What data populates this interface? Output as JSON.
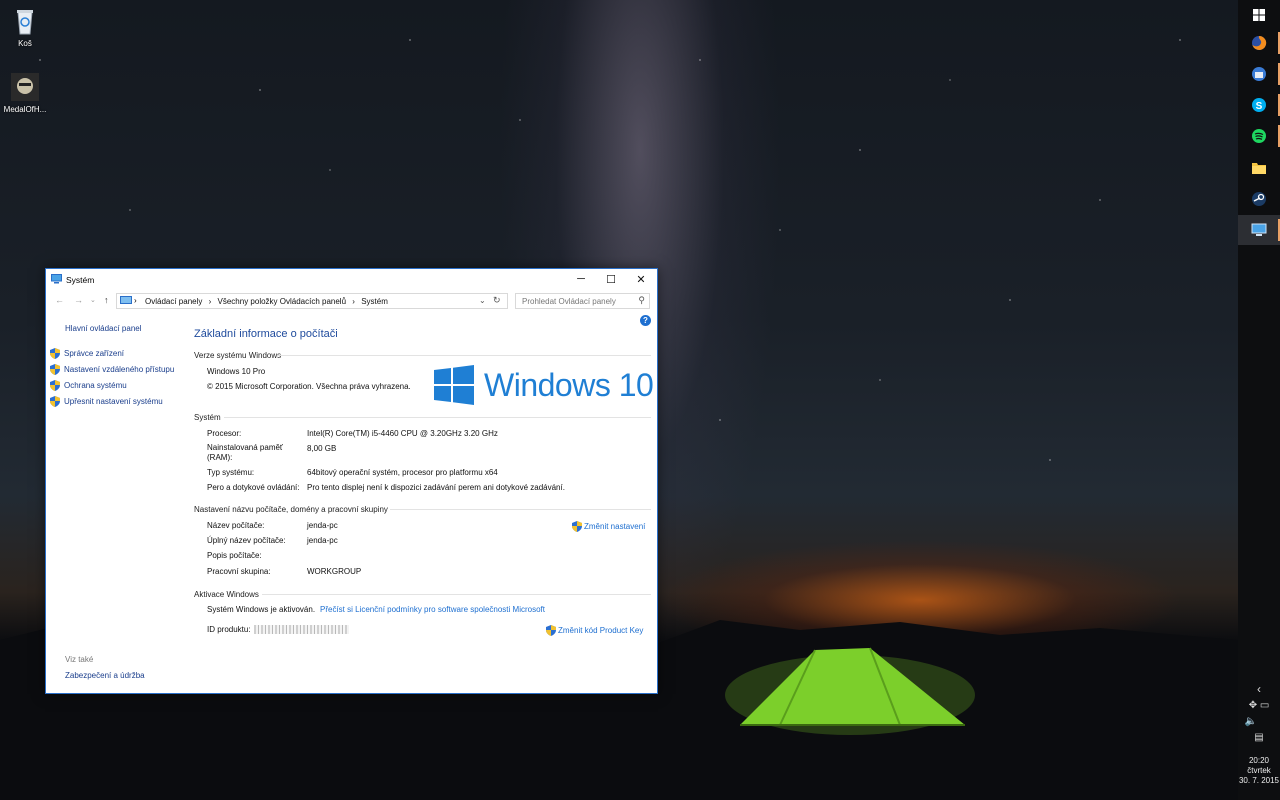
{
  "desktop": {
    "icons": [
      {
        "label": "Koš",
        "icon": "recycle-bin-icon"
      },
      {
        "label": "MedalOfH...",
        "icon": "game-icon"
      }
    ]
  },
  "taskbar": {
    "pinned": [
      {
        "name": "start-button",
        "icon": "windows-logo"
      },
      {
        "name": "firefox",
        "icon": "firefox-icon"
      },
      {
        "name": "thunderbird",
        "icon": "thunderbird-icon"
      },
      {
        "name": "skype",
        "icon": "skype-icon"
      },
      {
        "name": "spotify",
        "icon": "spotify-icon"
      },
      {
        "name": "file-explorer",
        "icon": "folder-icon"
      },
      {
        "name": "steam",
        "icon": "steam-icon"
      },
      {
        "name": "system-control-panel",
        "icon": "system-icon"
      }
    ],
    "tray": {
      "chevron": "‹",
      "time": "20:20",
      "day": "čtvrtek",
      "date": "30. 7. 2015"
    },
    "accent_color": "#e8a066"
  },
  "window": {
    "title": "Systém",
    "controls": {
      "minimize": "─",
      "maximize": "☐",
      "close": "✕"
    },
    "address": {
      "crumbs": [
        "Ovládací panely",
        "Všechny položky Ovládacích panelů",
        "Systém"
      ],
      "separator": "›"
    },
    "search_placeholder": "Prohledat Ovládací panely",
    "sidebar": {
      "home": "Hlavní ovládací panel",
      "links": [
        "Správce zařízení",
        "Nastavení vzdáleného přístupu",
        "Ochrana systému",
        "Upřesnit nastavení systému"
      ],
      "see_also": "Viz také",
      "see_also_links": [
        "Zabezpečení a údržba"
      ]
    },
    "main": {
      "title": "Základní informace o počítači",
      "help": "?",
      "edition": {
        "heading": "Verze systému Windows",
        "name": "Windows 10 Pro",
        "copyright": "© 2015 Microsoft Corporation. Všechna práva vyhrazena.",
        "logo_text": "Windows 10"
      },
      "system": {
        "heading": "Systém",
        "processor_label": "Procesor:",
        "processor_value": "Intel(R) Core(TM) i5-4460  CPU @ 3.20GHz   3.20 GHz",
        "ram_label_1": "Nainstalovaná paměť",
        "ram_label_2": "(RAM):",
        "ram_value": "8,00 GB",
        "type_label": "Typ systému:",
        "type_value": "64bitový operační systém, procesor pro platformu x64",
        "pen_label": "Pero a dotykové ovládání:",
        "pen_value": "Pro tento displej není k dispozici zadávání perem ani dotykové zadávání."
      },
      "computer_name": {
        "heading": "Nastavení názvu počítače, domény a pracovní skupiny",
        "name_label": "Název počítače:",
        "name_value": "jenda-pc",
        "full_label": "Úplný název počítače:",
        "full_value": "jenda-pc",
        "desc_label": "Popis počítače:",
        "desc_value": "",
        "workgroup_label": "Pracovní skupina:",
        "workgroup_value": "WORKGROUP",
        "change_link": "Změnit nastavení"
      },
      "activation": {
        "heading": "Aktivace Windows",
        "status": "Systém Windows je aktivován.",
        "license_link": "Přečíst si Licenční podmínky pro software společnosti Microsoft",
        "product_id_label": "ID produktu:",
        "change_key_link": "Změnit kód Product Key"
      }
    }
  }
}
